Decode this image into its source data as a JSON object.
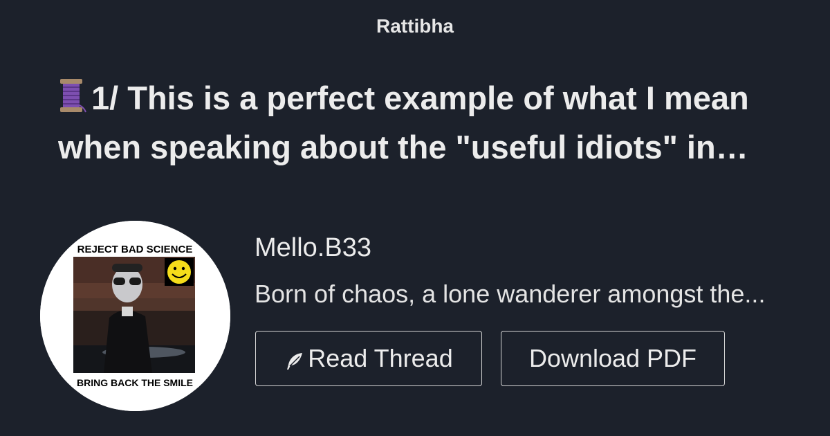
{
  "site": {
    "name": "Rattibha"
  },
  "thread": {
    "icon": "thread-spool-icon",
    "title": "1/ This is a perfect example of what I mean when speaking about the \"useful idiots\" in…"
  },
  "author": {
    "name": "Mello.B33",
    "bio": "Born of chaos, a lone wanderer amongst the...",
    "avatar": {
      "top_text": "REJECT BAD SCIENCE",
      "bottom_text": "BRING BACK THE SMILE"
    }
  },
  "actions": {
    "read_label": "Read Thread",
    "read_icon": "feather-icon",
    "pdf_label": "Download PDF"
  },
  "colors": {
    "background": "#1c212b",
    "text": "#ececec",
    "button_border": "#d6d6d6",
    "spool_purple": "#7d4fb0"
  }
}
